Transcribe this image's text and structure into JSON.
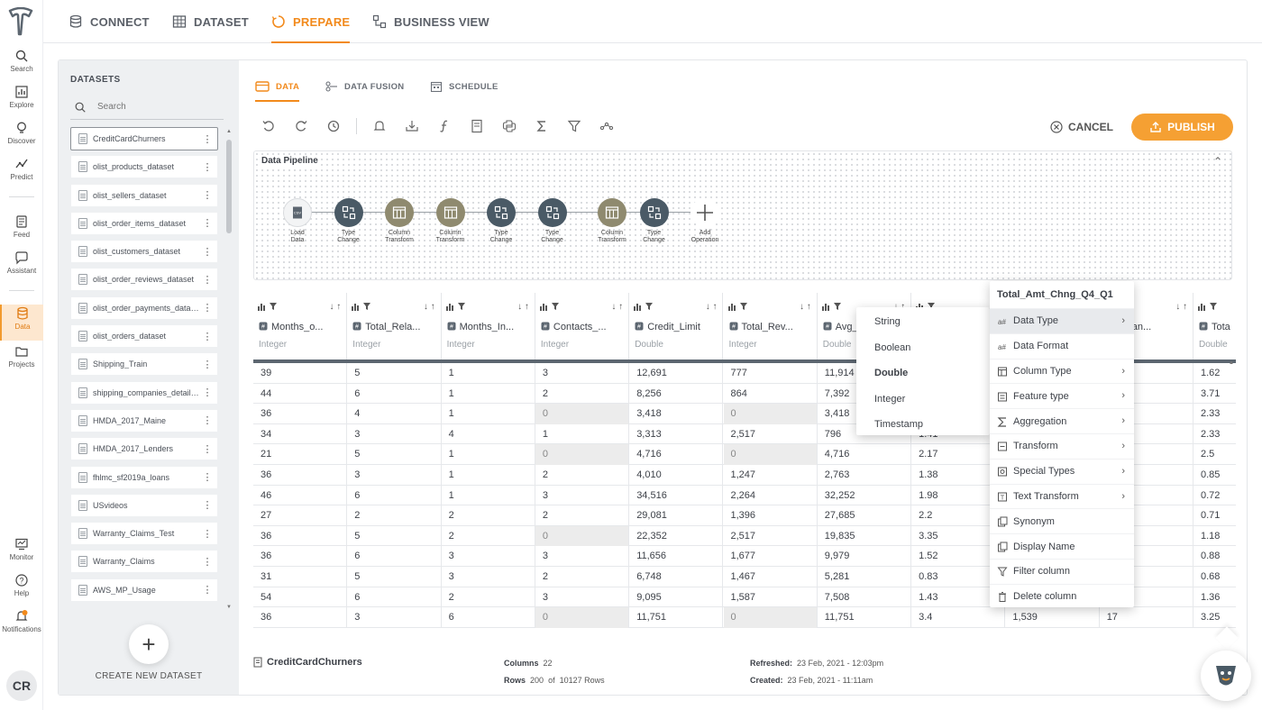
{
  "rail": {
    "items": [
      {
        "label": "Search",
        "icon": "search-icon"
      },
      {
        "label": "Explore",
        "icon": "chart-icon"
      },
      {
        "label": "Discover",
        "icon": "bulb-icon"
      },
      {
        "label": "Predict",
        "icon": "predict-icon"
      },
      {
        "label": "Feed",
        "icon": "feed-icon"
      },
      {
        "label": "Assistant",
        "icon": "chat-icon"
      },
      {
        "label": "Data",
        "icon": "database-icon"
      },
      {
        "label": "Projects",
        "icon": "folder-icon"
      },
      {
        "label": "Monitor",
        "icon": "monitor-icon"
      },
      {
        "label": "Help",
        "icon": "help-icon"
      },
      {
        "label": "Notifications",
        "icon": "bell-icon"
      }
    ],
    "avatar": "CR",
    "accent": "#f28a1c"
  },
  "topnav": {
    "tabs": [
      {
        "label": "CONNECT",
        "icon": "database-icon"
      },
      {
        "label": "DATASET",
        "icon": "grid-icon"
      },
      {
        "label": "PREPARE",
        "icon": "prepare-icon"
      },
      {
        "label": "BUSINESS VIEW",
        "icon": "business-view-icon"
      }
    ]
  },
  "datasets": {
    "title": "DATASETS",
    "search_placeholder": "Search",
    "items": [
      "CreditCardChurners",
      "olist_products_dataset",
      "olist_sellers_dataset",
      "olist_order_items_dataset",
      "olist_customers_dataset",
      "olist_order_reviews_dataset",
      "olist_order_payments_dataset",
      "olist_orders_dataset",
      "Shipping_Train",
      "shipping_companies_details...",
      "HMDA_2017_Maine",
      "HMDA_2017_Lenders",
      "fhlmc_sf2019a_loans",
      "USvideos",
      "Warranty_Claims_Test",
      "Warranty_Claims",
      "AWS_MP_Usage"
    ],
    "create_label": "CREATE NEW DATASET"
  },
  "subtabs": [
    "DATA",
    "DATA FUSION",
    "SCHEDULE"
  ],
  "actions": {
    "cancel": "CANCEL",
    "publish": "PUBLISH",
    "publish_color": "#f5a033"
  },
  "pipeline": {
    "title": "Data Pipeline",
    "nodes": [
      {
        "label": "Load\nData",
        "kind": "load"
      },
      {
        "label": "Type\nChange",
        "kind": "type"
      },
      {
        "label": "Column\nTransform",
        "kind": "col"
      },
      {
        "label": "Column\nTransform",
        "kind": "col"
      },
      {
        "label": "Type\nChange",
        "kind": "type"
      },
      {
        "label": "Type\nChange",
        "kind": "type"
      },
      {
        "label": "Column\nTransform",
        "kind": "col"
      },
      {
        "label": "Type\nChange",
        "kind": "type"
      },
      {
        "label": "Add\nOperation",
        "kind": "add"
      }
    ]
  },
  "table": {
    "columns": [
      {
        "name": "Months_o...",
        "type": "Integer"
      },
      {
        "name": "Total_Rela...",
        "type": "Integer"
      },
      {
        "name": "Months_In...",
        "type": "Integer"
      },
      {
        "name": "Contacts_...",
        "type": "Integer"
      },
      {
        "name": "Credit_Limit",
        "type": "Double"
      },
      {
        "name": "Total_Rev...",
        "type": "Integer"
      },
      {
        "name": "Avg_",
        "type": "Double"
      },
      {
        "name": "",
        "type": ""
      },
      {
        "name": "",
        "type": ""
      },
      {
        "name": "_Tran...",
        "type": ""
      },
      {
        "name": "Tota",
        "type": "Double"
      }
    ],
    "rows": [
      [
        "39",
        "5",
        "1",
        "3",
        "12,691",
        "777",
        "11,914",
        "",
        "",
        "",
        "1.62"
      ],
      [
        "44",
        "6",
        "1",
        "2",
        "8,256",
        "864",
        "7,392",
        "",
        "",
        "",
        "3.71"
      ],
      [
        "36",
        "4",
        "1",
        "0",
        "3,418",
        "0",
        "3,418",
        "",
        "",
        "",
        "2.33"
      ],
      [
        "34",
        "3",
        "4",
        "1",
        "3,313",
        "2,517",
        "796",
        "1.41",
        "",
        "",
        "2.33"
      ],
      [
        "21",
        "5",
        "1",
        "0",
        "4,716",
        "0",
        "4,716",
        "2.17",
        "",
        "",
        "2.5"
      ],
      [
        "36",
        "3",
        "1",
        "2",
        "4,010",
        "1,247",
        "2,763",
        "1.38",
        "",
        "",
        "0.85"
      ],
      [
        "46",
        "6",
        "1",
        "3",
        "34,516",
        "2,264",
        "32,252",
        "1.98",
        "",
        "",
        "0.72"
      ],
      [
        "27",
        "2",
        "2",
        "2",
        "29,081",
        "1,396",
        "27,685",
        "2.2",
        "",
        "",
        "0.71"
      ],
      [
        "36",
        "5",
        "2",
        "0",
        "22,352",
        "2,517",
        "19,835",
        "3.35",
        "",
        "",
        "1.18"
      ],
      [
        "36",
        "6",
        "3",
        "3",
        "11,656",
        "1,677",
        "9,979",
        "1.52",
        "",
        "",
        "0.88"
      ],
      [
        "31",
        "5",
        "3",
        "2",
        "6,748",
        "1,467",
        "5,281",
        "0.83",
        "",
        "",
        "0.68"
      ],
      [
        "54",
        "6",
        "2",
        "3",
        "9,095",
        "1,587",
        "7,508",
        "1.43",
        "",
        "",
        "1.36"
      ],
      [
        "36",
        "3",
        "6",
        "0",
        "11,751",
        "0",
        "11,751",
        "3.4",
        "1,539",
        "17",
        "3.25"
      ]
    ],
    "highlight_zero_cols": [
      3,
      5
    ]
  },
  "context_menu": {
    "title": "Total_Amt_Chng_Q4_Q1",
    "items": [
      {
        "label": "Data Type",
        "icon": "data-type-icon",
        "submenu": true,
        "active": true
      },
      {
        "label": "Data Format",
        "icon": "data-format-icon",
        "submenu": false
      },
      {
        "label": "Column Type",
        "icon": "column-type-icon",
        "submenu": true
      },
      {
        "label": "Feature type",
        "icon": "feature-type-icon",
        "submenu": true
      },
      {
        "label": "Aggregation",
        "icon": "sigma-icon",
        "submenu": true
      },
      {
        "label": "Transform",
        "icon": "transform-icon",
        "submenu": true
      },
      {
        "label": "Special Types",
        "icon": "special-types-icon",
        "submenu": true
      },
      {
        "label": "Text Transform",
        "icon": "text-transform-icon",
        "submenu": true
      },
      {
        "label": "Synonym",
        "icon": "synonym-icon",
        "submenu": false
      },
      {
        "label": "Display Name",
        "icon": "display-name-icon",
        "submenu": false
      },
      {
        "label": "Filter column",
        "icon": "filter-icon",
        "submenu": false
      },
      {
        "label": "Delete column",
        "icon": "trash-icon",
        "submenu": false
      }
    ]
  },
  "datatype_submenu": {
    "options": [
      "String",
      "Boolean",
      "Double",
      "Integer",
      "Timestamp"
    ],
    "selected": "Double"
  },
  "footer": {
    "dataset_name": "CreditCardChurners",
    "columns_label": "Columns",
    "columns_value": "22",
    "rows_label": "Rows",
    "rows_value": "200",
    "rows_of": "of",
    "rows_total": "10127 Rows",
    "refreshed_label": "Refreshed:",
    "refreshed_value": "23 Feb, 2021 - 12:03pm",
    "created_label": "Created:",
    "created_value": "23 Feb, 2021 - 11:11am"
  }
}
